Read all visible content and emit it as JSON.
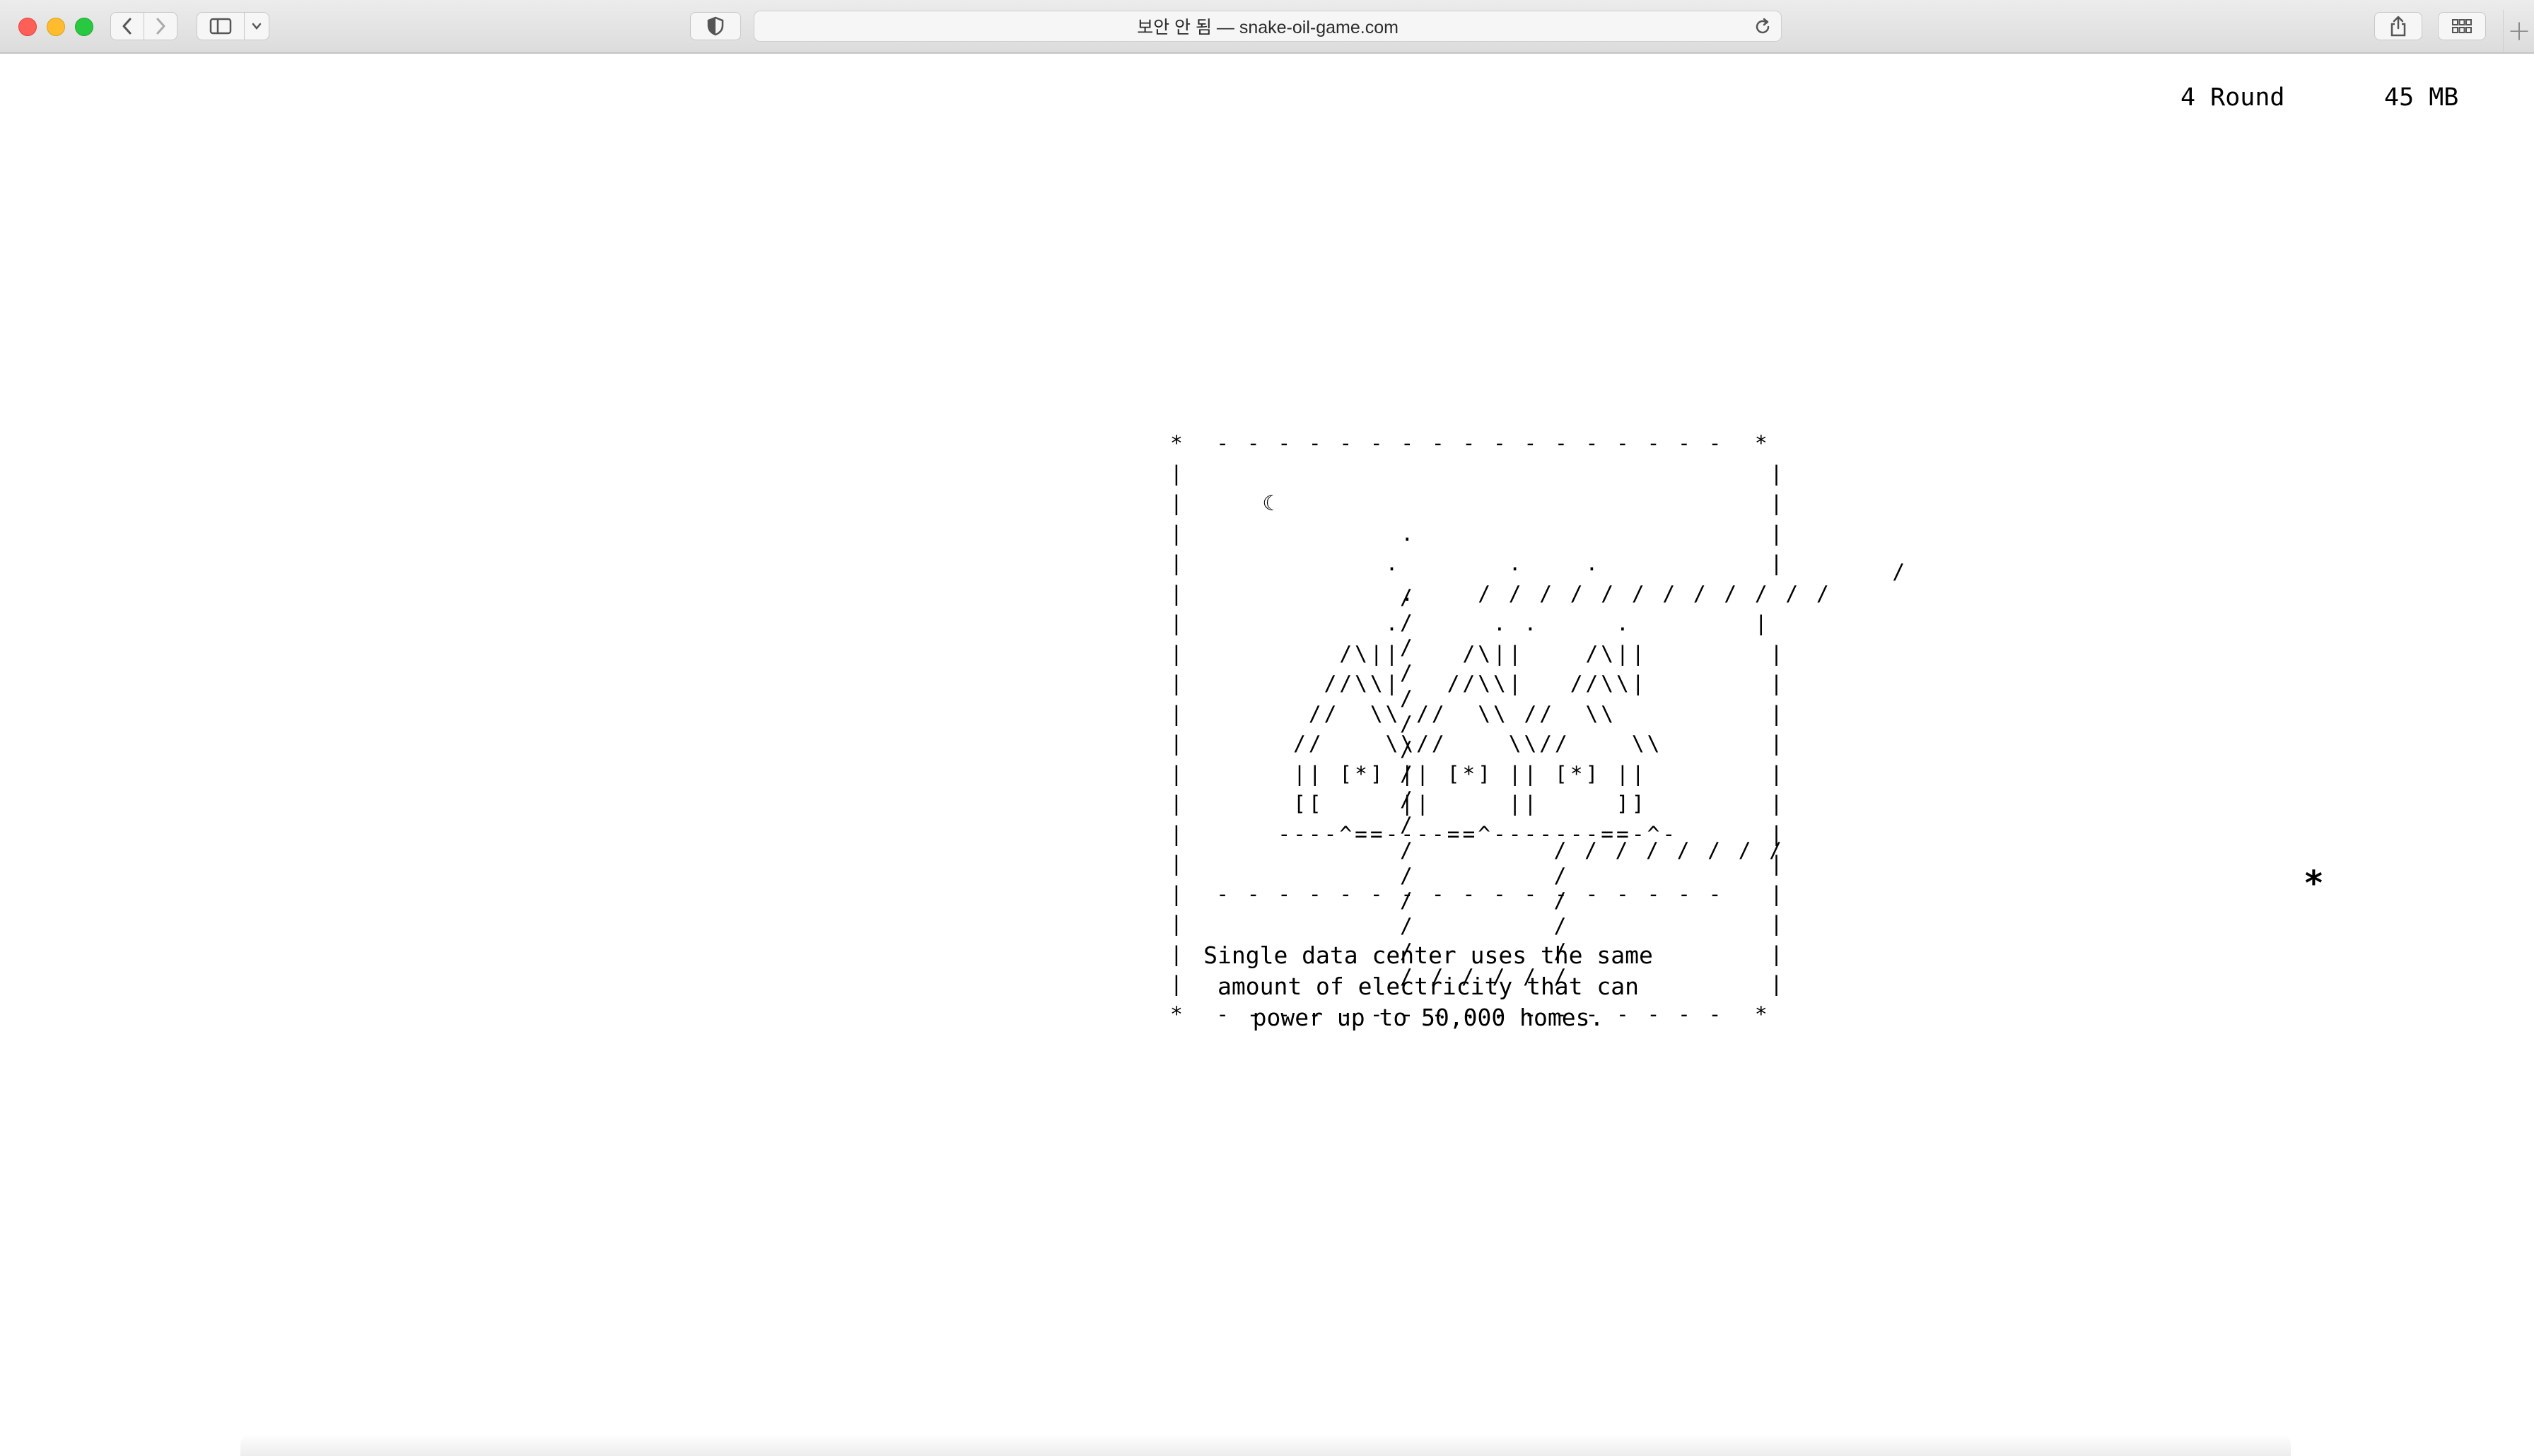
{
  "browser": {
    "address": "보안 안 됨 — snake-oil-game.com",
    "icons": {
      "back": "chevron-left-icon",
      "forward": "chevron-right-icon",
      "sidebar": "sidebar-icon",
      "sidebar_menu": "chevron-down-icon",
      "privacy": "shield-icon",
      "reload": "reload-icon",
      "share": "share-icon",
      "tabs": "tab-overview-icon",
      "new_tab": "plus-icon"
    }
  },
  "hud": {
    "round": "4 Round",
    "memory": "45 MB"
  },
  "scene": {
    "frame_art": "*  - - - - - - - - - - - - - - - - -  *\n|                                      |\n|     ☾                                |\n|              .                       |\n|             .       .    .           |\n|              .    / / / / / / / / / / / /\n|             .      . .     .        |\n|          /\\||    /\\||    /\\||        |\n|         //\\\\|   //\\\\|   //\\\\|        |\n|        //  \\\\ //  \\\\ //  \\\\          |\n|       //    \\\\//    \\\\//    \\\\       |\n|       || [*] || [*] || [*] ||        |\n|       [[     ||     ||     ]]        |\n|      ----^==----==^-------==-^-      |\n|                                      |\n|  - - - - - - - - - - - - - - - - -   |\n|                                      |\n|                                      |\n|                                      |\n*  - - - - - - - - - - - - - - - - -  *",
    "snake_art": "                                /\n/\n/\n/\n/\n/\n/\n/\n/\n/\n/\n/         / / / / / / / /\n/         /\n/         /\n/         /\n/         /\n/ / / / / /",
    "caption": "Single data center uses the same amount of electricity that can power up to 50,000 homes.",
    "food": "*"
  }
}
